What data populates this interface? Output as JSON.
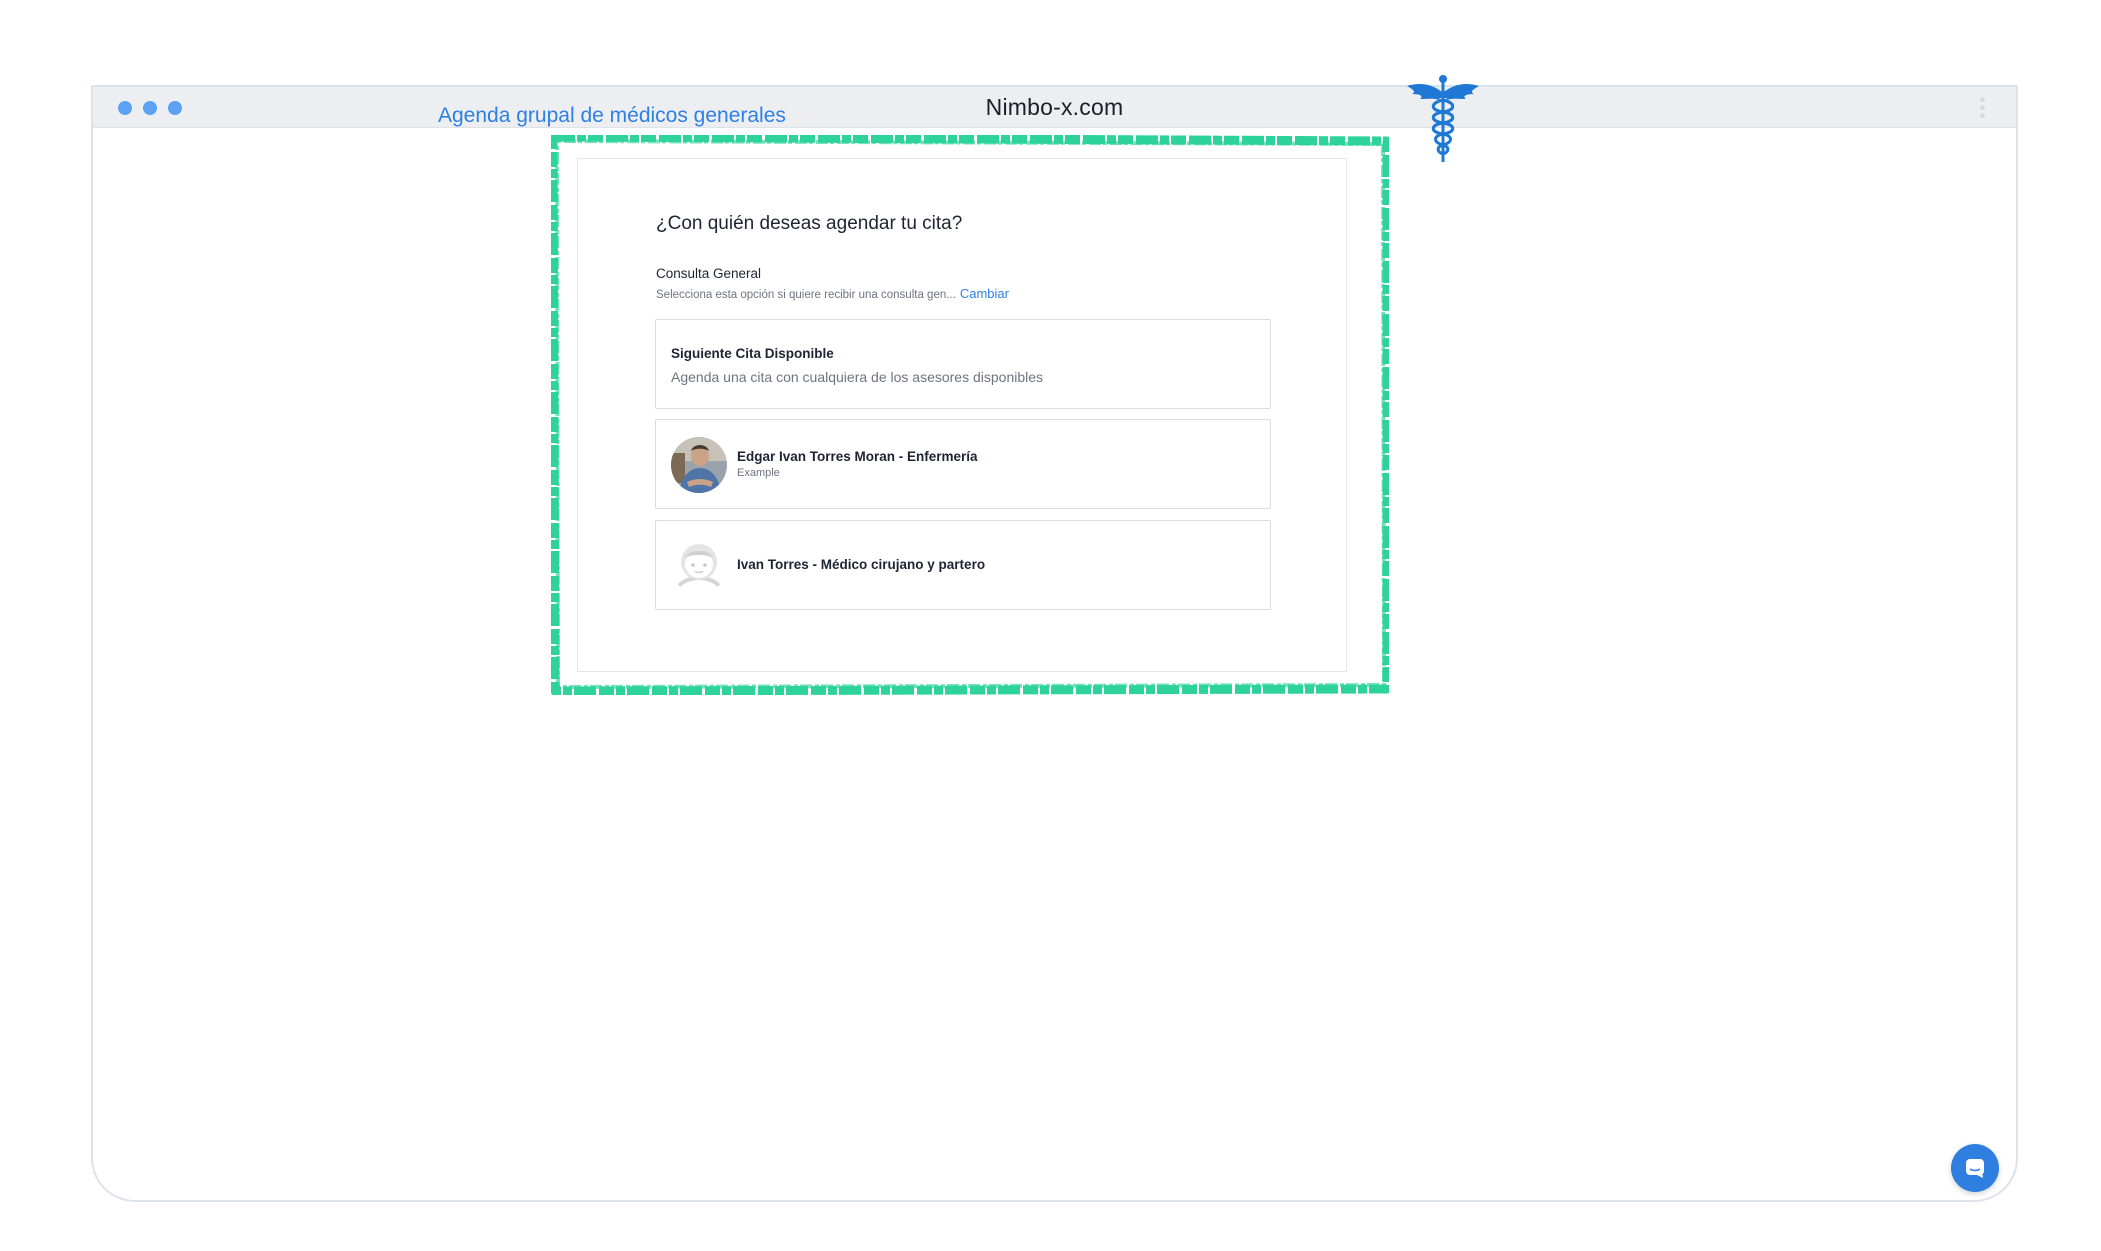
{
  "browser": {
    "site_title": "Nimbo-x.com"
  },
  "page": {
    "heading": "Agenda grupal de médicos generales",
    "logo_icon": "caduceus-icon"
  },
  "booking": {
    "question": "¿Con quién deseas agendar tu cita?",
    "service": {
      "name": "Consulta General",
      "description": "Selecciona esta opción si quiere recibir una consulta gen...",
      "change_label": "Cambiar"
    },
    "options": [
      {
        "title": "Siguiente Cita Disponible",
        "subtitle": "Agenda una cita con cualquiera de los asesores disponibles"
      },
      {
        "name": "Edgar Ivan Torres Moran - Enfermería",
        "subtitle": "Example",
        "avatar": "photo-avatar"
      },
      {
        "name": "Ivan Torres - Médico cirujano y partero",
        "avatar": "default-avatar"
      }
    ]
  },
  "chat": {
    "icon": "chat-icon"
  },
  "colors": {
    "accent": "#2f80e4",
    "frame_highlight": "#2ed39c",
    "window_dots": "#5ba2f2"
  }
}
